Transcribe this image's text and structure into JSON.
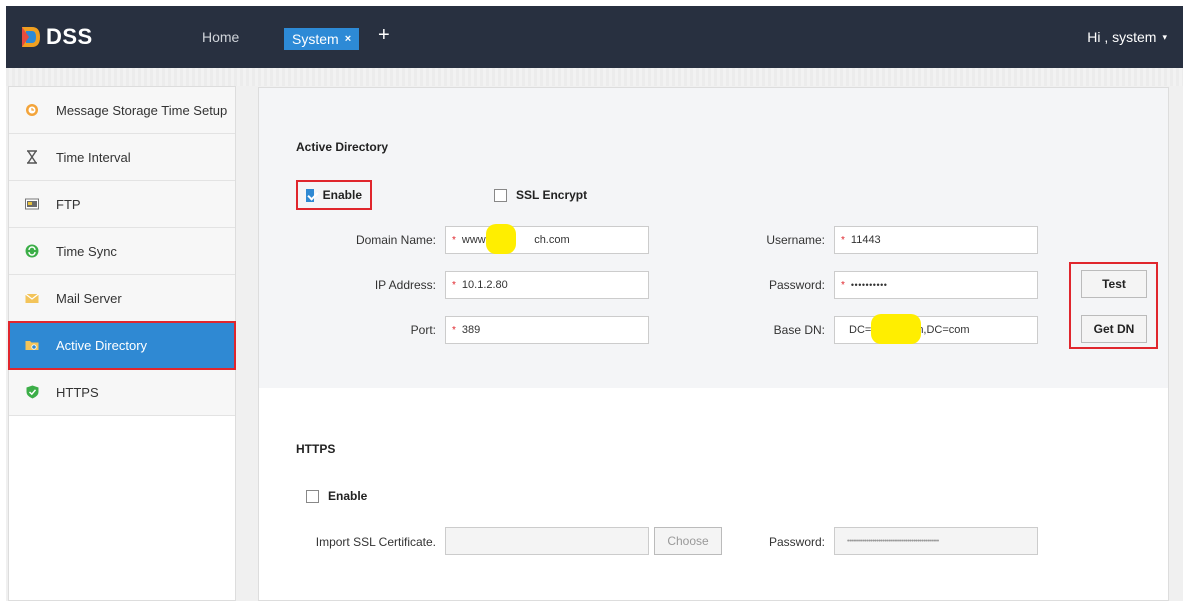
{
  "app": {
    "logo_text": "DSS",
    "home_label": "Home",
    "tab_label": "System",
    "tab_close": "×",
    "tab_add": "+",
    "user_greeting": "Hi , system",
    "user_caret": "▾"
  },
  "sidebar": {
    "items": [
      {
        "label": "Message Storage Time Setup",
        "icon": "clock-icon"
      },
      {
        "label": "Time Interval",
        "icon": "hourglass-icon"
      },
      {
        "label": "FTP",
        "icon": "ftp-icon"
      },
      {
        "label": "Time Sync",
        "icon": "sync-icon"
      },
      {
        "label": "Mail Server",
        "icon": "mail-icon"
      },
      {
        "label": "Active Directory",
        "icon": "folder-icon",
        "active": true
      },
      {
        "label": "HTTPS",
        "icon": "shield-icon"
      }
    ]
  },
  "active_directory": {
    "title": "Active Directory",
    "enable_label": "Enable",
    "enable_checked": true,
    "ssl_label": "SSL Encrypt",
    "ssl_checked": false,
    "fields": {
      "domain_label": "Domain Name:",
      "domain_value_start": "www.",
      "domain_value_end": "ch.com",
      "ip_label": "IP Address:",
      "ip_value": "10.1.2.80",
      "port_label": "Port:",
      "port_value": "389",
      "username_label": "Username:",
      "username_value": "11443",
      "password_label": "Password:",
      "password_value": "••••••••••",
      "basedn_label": "Base DN:",
      "basedn_value_start": "DC=",
      "basedn_value_end": "n,DC=com"
    },
    "required_mark": "*",
    "test_button": "Test",
    "getdn_button": "Get DN"
  },
  "https": {
    "title": "HTTPS",
    "enable_label": "Enable",
    "enable_checked": false,
    "cert_label": "Import SSL Certificate.",
    "choose_button": "Choose",
    "password_label": "Password:",
    "password_value": "•••••••••••••••••••••••••••••••••••••••••••••••"
  },
  "colors": {
    "accent": "#2f89d3",
    "header": "#283040",
    "highlight": "#e0262d",
    "redaction": "#ffee00"
  }
}
